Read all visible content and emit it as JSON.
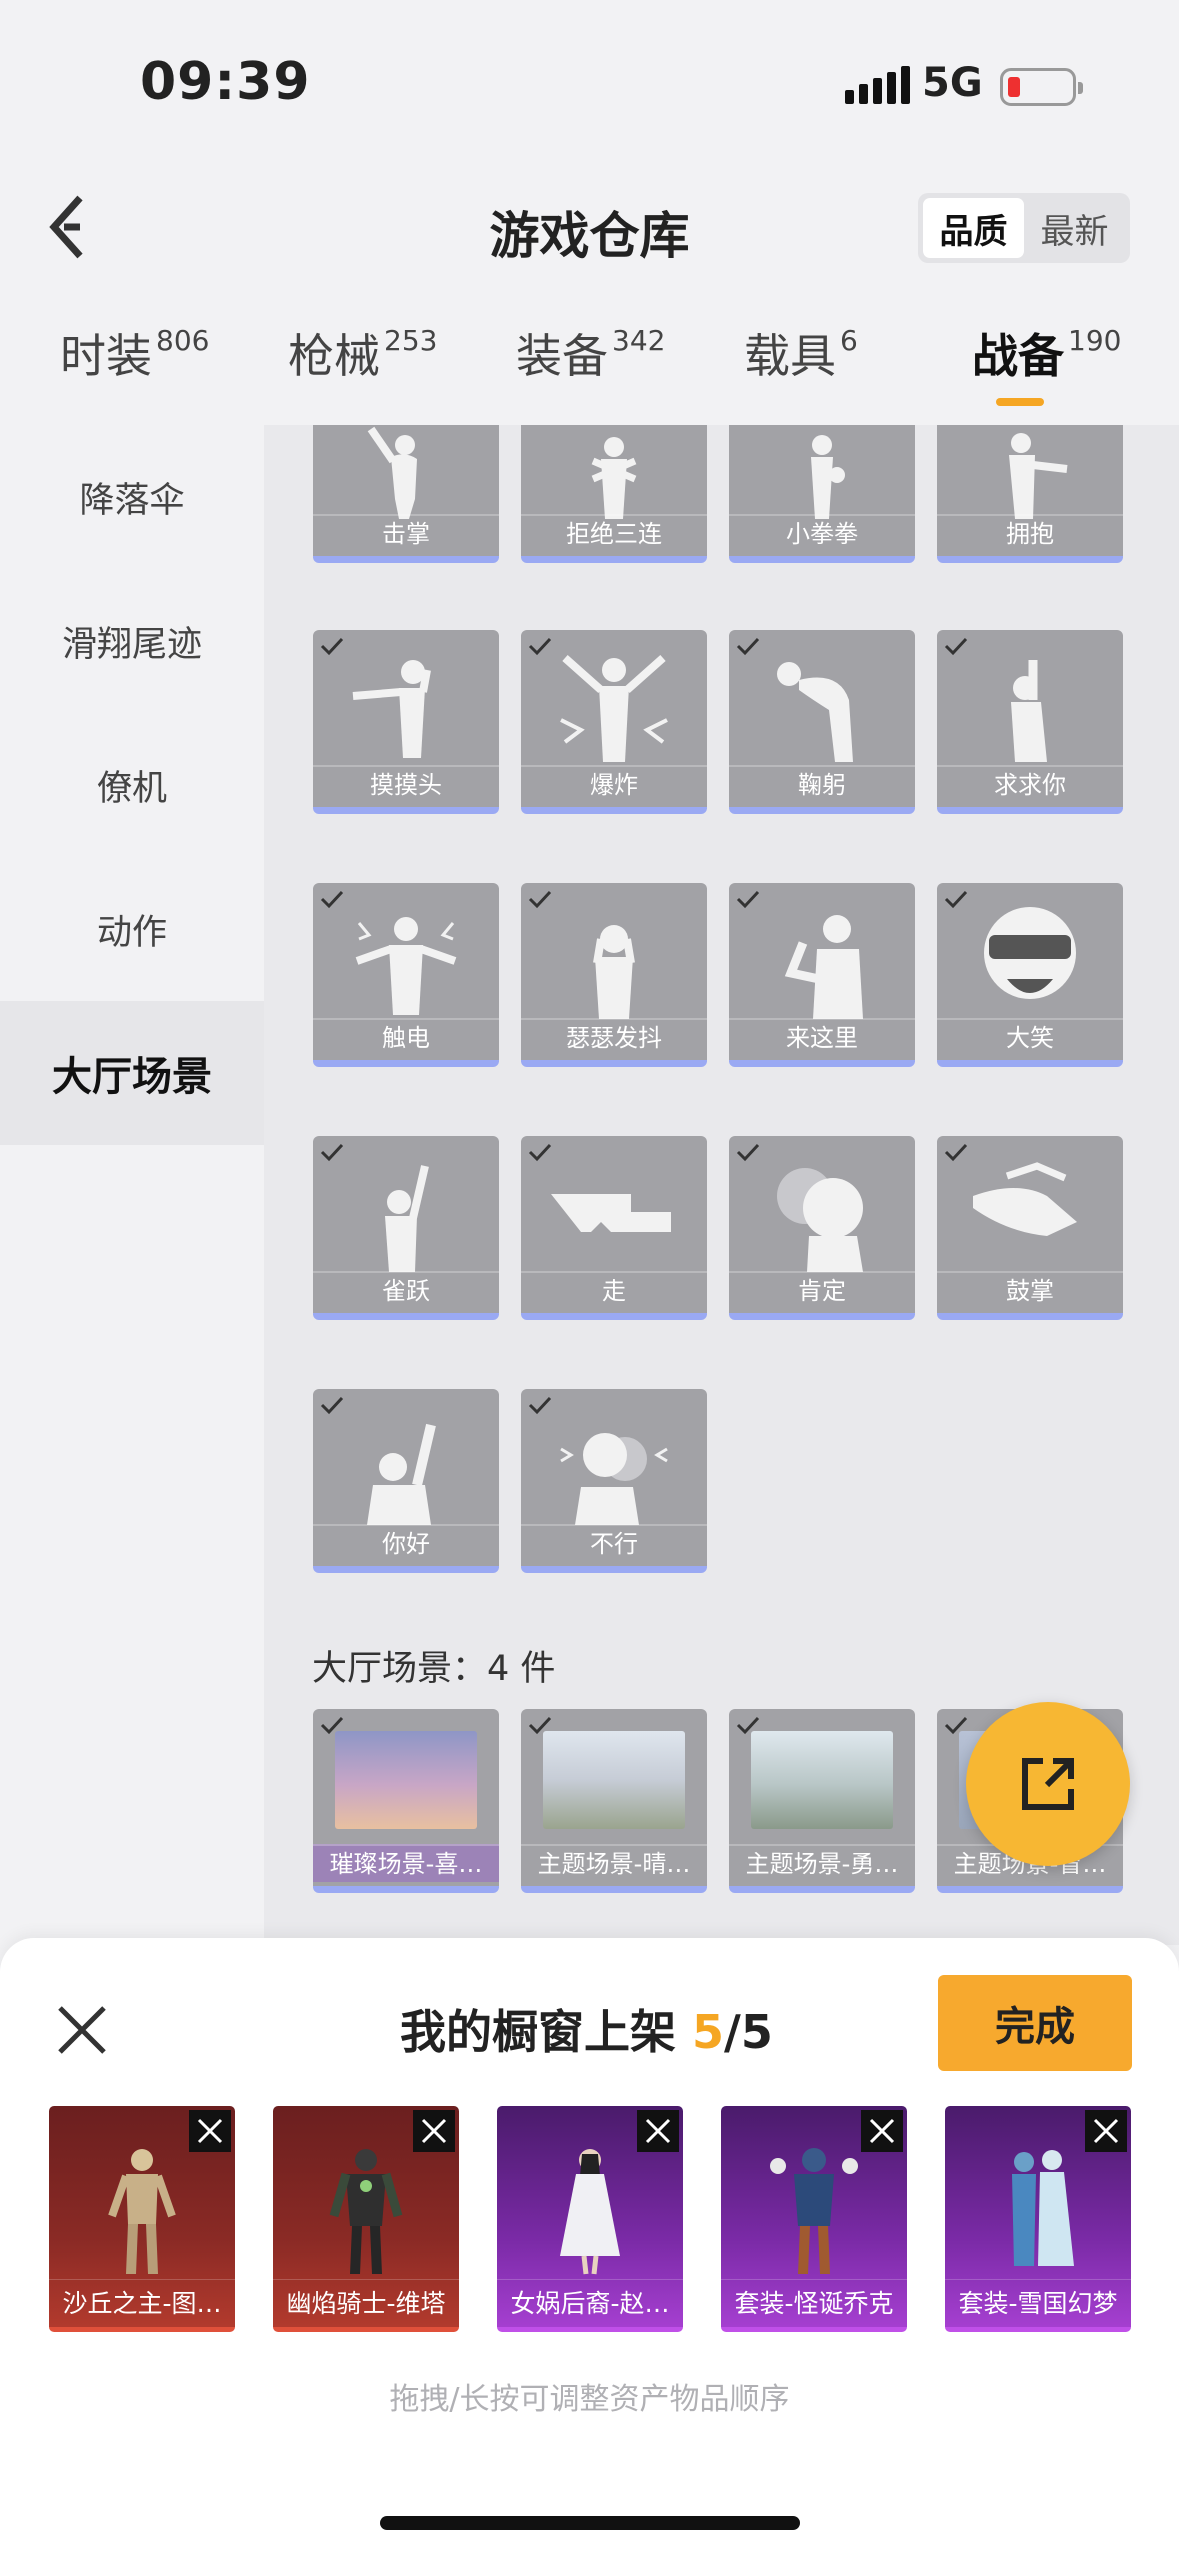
{
  "status_bar": {
    "time": "09:39",
    "network": "5G"
  },
  "header": {
    "title": "游戏仓库",
    "sort_options": [
      "品质",
      "最新"
    ]
  },
  "tabs": [
    {
      "label": "时装",
      "count": "806"
    },
    {
      "label": "枪械",
      "count": "253"
    },
    {
      "label": "装备",
      "count": "342"
    },
    {
      "label": "载具",
      "count": "6"
    },
    {
      "label": "战备",
      "count": "190"
    }
  ],
  "sidebar": {
    "items": [
      "降落伞",
      "滑翔尾迹",
      "僚机",
      "动作",
      "大厅场景"
    ]
  },
  "emotes": [
    "击掌",
    "拒绝三连",
    "小拳拳",
    "拥抱",
    "摸摸头",
    "爆炸",
    "鞠躬",
    "求求你",
    "触电",
    "瑟瑟发抖",
    "来这里",
    "大笑",
    "雀跃",
    "走",
    "肯定",
    "鼓掌",
    "你好",
    "不行"
  ],
  "scene_section": {
    "title": "大厅场景：4 件"
  },
  "scenes": [
    "璀璨场景-喜…",
    "主题场景-晴…",
    "主题场景-勇…",
    "主题场景-冒…"
  ],
  "showcase": {
    "title_prefix": "我的橱窗上架 ",
    "count": "5",
    "total": "/5",
    "done_label": "完成",
    "items": [
      "沙丘之主-图…",
      "幽焰骑士-维塔",
      "女娲后裔-赵…",
      "套装-怪诞乔克",
      "套装-雪国幻梦"
    ],
    "hint": "拖拽/长按可调整资产物品顺序"
  },
  "colors": {
    "accent": "#f5a623",
    "card_bg": "#a2a2a6",
    "card_border": "#9aa9f3",
    "red_rarity": "#b23a2d",
    "purple_rarity": "#a53fd0"
  }
}
